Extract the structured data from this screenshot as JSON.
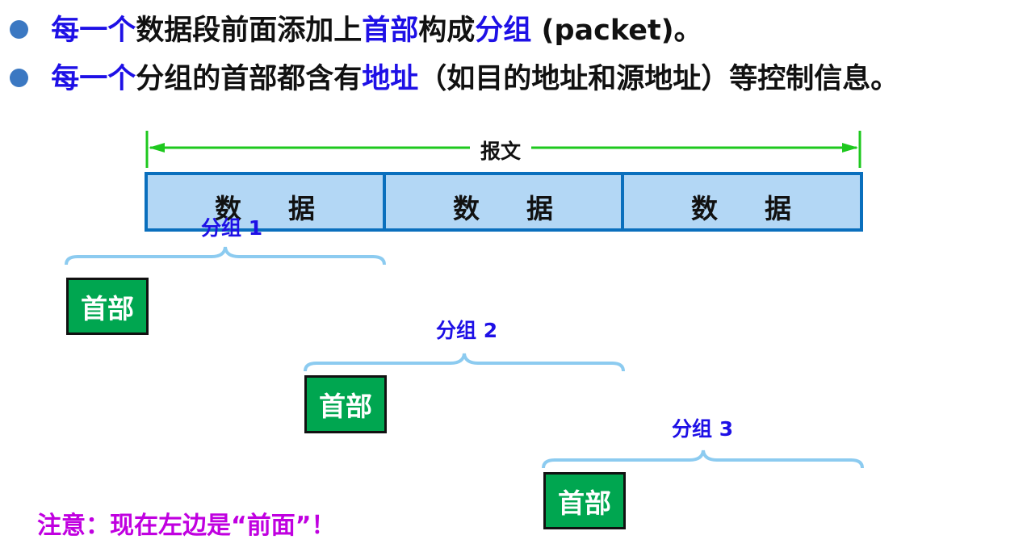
{
  "bullets": [
    [
      {
        "text": "每一个",
        "highlight": true
      },
      {
        "text": "数据段前面添加上",
        "highlight": false
      },
      {
        "text": "首部",
        "highlight": true
      },
      {
        "text": "构成",
        "highlight": false
      },
      {
        "text": "分组",
        "highlight": true
      },
      {
        "text": " (packet)。",
        "highlight": false
      }
    ],
    [
      {
        "text": "每一个",
        "highlight": true
      },
      {
        "text": "分组的首部都含有",
        "highlight": false
      },
      {
        "text": "地址",
        "highlight": true
      },
      {
        "text": "（如目的地址和源地址）等控制信息。",
        "highlight": false
      }
    ]
  ],
  "diagram": {
    "message_label": "报文",
    "segment_text": [
      "数",
      "据"
    ],
    "segments_count": 3,
    "packets": [
      {
        "label": "分组 1",
        "header": "首部"
      },
      {
        "label": "分组 2",
        "header": "首部"
      },
      {
        "label": "分组 3",
        "header": "首部"
      }
    ]
  },
  "note": "注意：现在左边是“前面”！",
  "colors": {
    "highlight": "#1e10e6",
    "segment_fill": "#b3d7f5",
    "segment_border": "#0a6fbd",
    "arrow": "#1ec81e",
    "brace": "#8ccbf0",
    "header_fill": "#00a650",
    "note": "#c000e0",
    "bullet_dot": "#3b78c2"
  }
}
